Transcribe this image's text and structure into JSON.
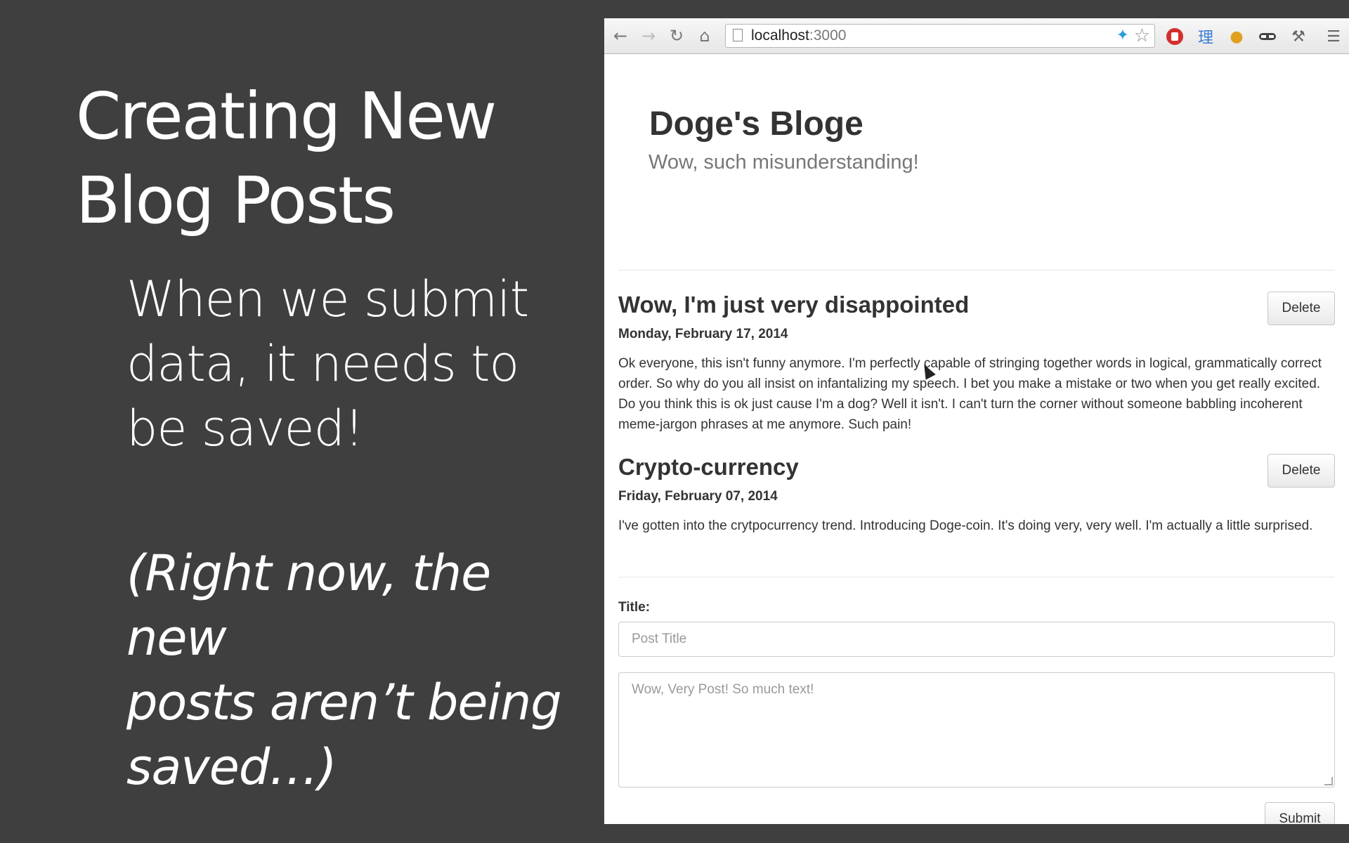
{
  "slide": {
    "title_lines": [
      "Creating New",
      "Blog Posts"
    ],
    "body_lines": [
      "When we submit",
      "data, it needs to",
      "be saved!"
    ],
    "note_lines": [
      "(Right now, the new",
      "posts aren’t being",
      "saved…)"
    ]
  },
  "browser": {
    "url_host": "localhost",
    "url_port": ":3000",
    "nav_icons": [
      "back-arrow-icon",
      "forward-arrow-icon",
      "reload-icon",
      "home-icon"
    ],
    "extension_icons": [
      "adblock-icon",
      "chinese-char-icon",
      "bird-icon",
      "mask-icon",
      "wrench-icon",
      "menu-icon"
    ],
    "extension_char": "理"
  },
  "blog": {
    "title": "Doge's Bloge",
    "subtitle": "Wow, such misunderstanding!",
    "posts": [
      {
        "title": "Wow, I'm just very disappointed",
        "date": "Monday, February 17, 2014",
        "body": "Ok everyone, this isn't funny anymore. I'm perfectly capable of stringing together words in logical, grammatically correct order. So why do you all insist on infantalizing my speech. I bet you make a mistake or two when you get really excited. Do you think this is ok just cause I'm a dog? Well it isn't. I can't turn the corner without someone babbling incoherent meme-jargon phrases at me anymore. Such pain!",
        "delete_label": "Delete"
      },
      {
        "title": "Crypto-currency",
        "date": "Friday, February 07, 2014",
        "body": "I've gotten into the crytpocurrency trend. Introducing Doge-coin. It's doing very, very well. I'm actually a little surprised.",
        "delete_label": "Delete"
      }
    ],
    "form": {
      "title_label": "Title:",
      "title_placeholder": "Post Title",
      "body_placeholder": "Wow, Very Post!  So much text!",
      "submit_label": "Submit"
    }
  }
}
